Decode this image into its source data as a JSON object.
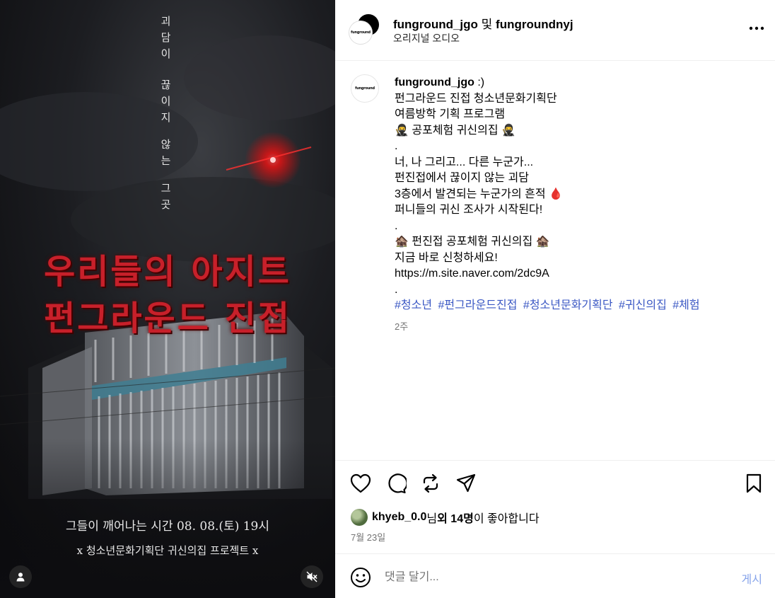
{
  "post": {
    "header": {
      "account1": "funground_jgo",
      "joiner": "및",
      "account2": "fungroundnyj",
      "audio": "오리지널 오디오",
      "avatar_logo": "funground"
    },
    "media": {
      "vertical_text": [
        "괴담이",
        "끊이지",
        "않는",
        "그곳"
      ],
      "title_line1": "우리들의 아지트",
      "title_line2": "펀그라운드 진접",
      "bottom_line1": "그들이 깨어나는 시간 08. 08.(토) 19시",
      "bottom_line2": "x 청소년문화기획단 귀신의집 프로젝트 x",
      "user_icon": "user-icon",
      "mute_icon": "speaker-muted-icon"
    },
    "caption": {
      "username": "funground_jgo",
      "first_text": ":)",
      "lines": [
        "펀그라운드 진접 청소년문화기획단",
        "여름방학 기획 프로그램",
        "🥷 공포체험 귀신의집 🥷",
        ".",
        "너, 나 그리고... 다른 누군가...",
        "펀진접에서 끊이지 않는 괴담",
        "3층에서 발견되는 누군가의 흔적 🩸",
        "퍼니들의 귀신 조사가 시작된다!",
        ".",
        "🏚️ 펀진접 공포체험 귀신의집 🏚️",
        "지금 바로 신청하세요!",
        "https://m.site.naver.com/2dc9A",
        "."
      ],
      "hashtags": [
        "#청소년",
        "#펀그라운드진접",
        "#청소년문화기획단",
        "#귀신의집",
        "#체험"
      ],
      "time_ago": "2주"
    },
    "likes": {
      "user": "khyeb_0.0",
      "suffix1": "님 ",
      "others": "외 14명",
      "suffix2": "이 좋아합니다"
    },
    "date": "7월 23일",
    "comment": {
      "placeholder": "댓글 달기...",
      "post_label": "게시"
    },
    "icons": [
      "heart-icon",
      "comment-icon",
      "repost-icon",
      "share-icon",
      "bookmark-icon",
      "more-icon",
      "emoji-icon"
    ]
  }
}
